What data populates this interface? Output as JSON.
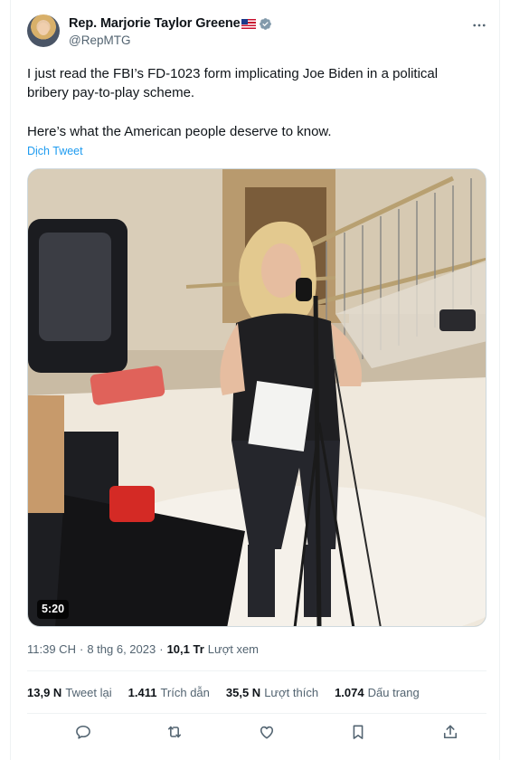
{
  "author": {
    "display_name": "Rep. Marjorie Taylor Greene",
    "handle": "@RepMTG",
    "flag_icon": "us-flag-icon",
    "verified_icon": "verified-badge-icon",
    "verified_color": "#829aab"
  },
  "tweet": {
    "line1": "I just read the FBI’s FD-1023 form implicating Joe Biden in a political",
    "line2": "bribery pay-to-play scheme.",
    "line3": "Here’s what the American people deserve to know.",
    "translate_label": "Dịch Tweet"
  },
  "media": {
    "duration": "5:20"
  },
  "meta": {
    "time": "11:39 CH",
    "date": "8 thg 6, 2023",
    "separator": "·",
    "views_count": "10,1 Tr",
    "views_label": "Lượt xem"
  },
  "stats": [
    {
      "count": "13,9 N",
      "label": "Tweet lại"
    },
    {
      "count": "1.411",
      "label": "Trích dẫn"
    },
    {
      "count": "35,5 N",
      "label": "Lượt thích"
    },
    {
      "count": "1.074",
      "label": "Dấu trang"
    }
  ],
  "actions": [
    "reply-icon",
    "retweet-icon",
    "like-icon",
    "bookmark-icon",
    "share-icon"
  ],
  "colors": {
    "accent": "#1d9bf0",
    "text_primary": "#0f1419",
    "text_secondary": "#536471",
    "divider": "#eff3f4"
  }
}
